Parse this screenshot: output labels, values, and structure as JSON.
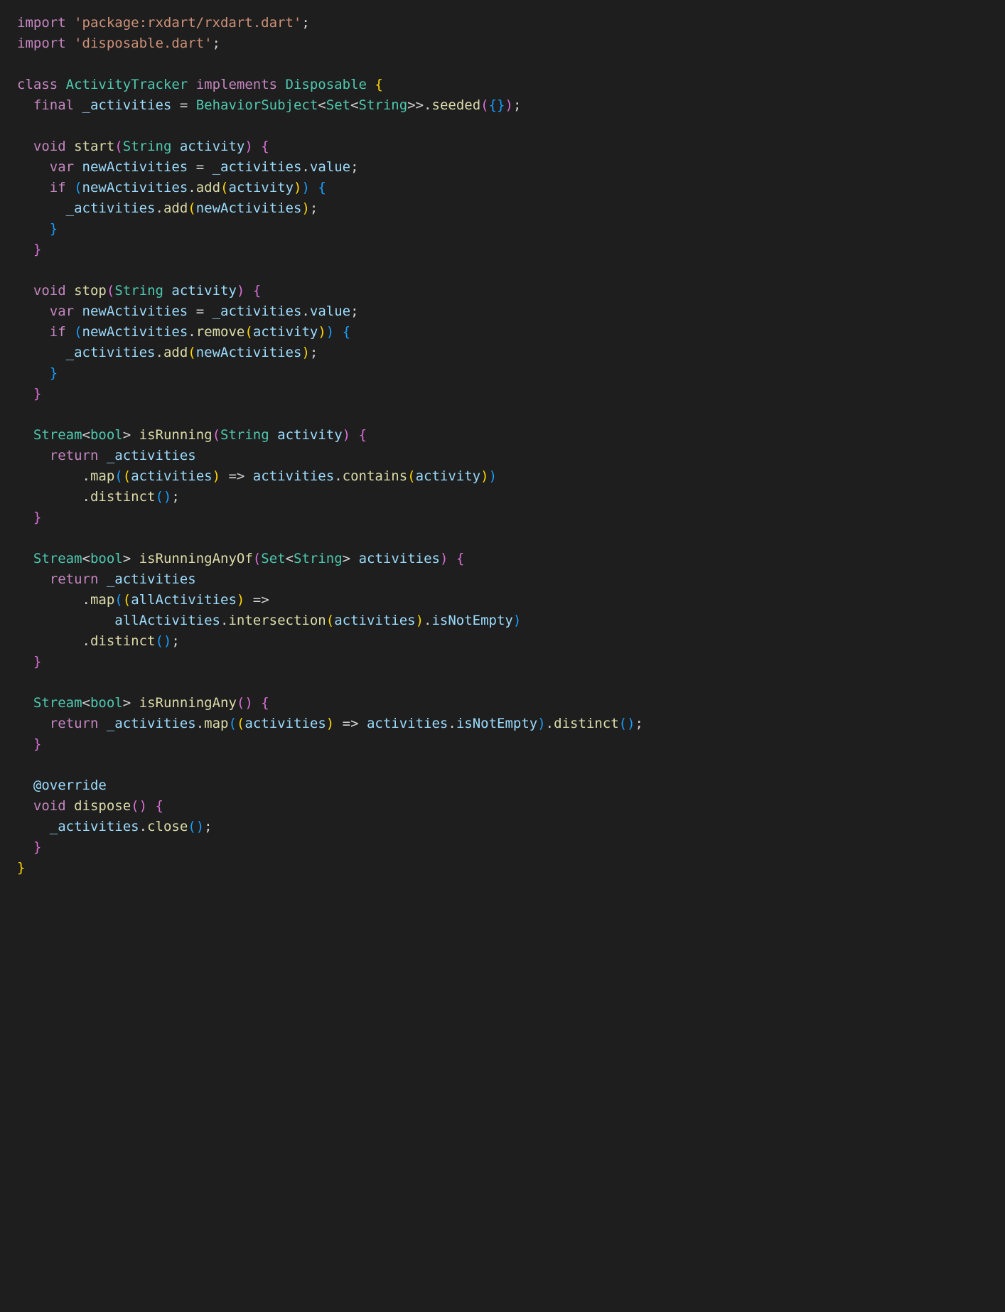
{
  "lines": [
    [
      {
        "t": "import ",
        "c": "kw"
      },
      {
        "t": "'package:rxdart/rxdart.dart'",
        "c": "str"
      },
      {
        "t": ";",
        "c": "punc"
      }
    ],
    [
      {
        "t": "import ",
        "c": "kw"
      },
      {
        "t": "'disposable.dart'",
        "c": "str"
      },
      {
        "t": ";",
        "c": "punc"
      }
    ],
    [],
    [
      {
        "t": "class ",
        "c": "kw"
      },
      {
        "t": "ActivityTracker",
        "c": "type"
      },
      {
        "t": " ",
        "c": "punc"
      },
      {
        "t": "implements ",
        "c": "kw"
      },
      {
        "t": "Disposable",
        "c": "type"
      },
      {
        "t": " ",
        "c": "punc"
      },
      {
        "t": "{",
        "c": "brace-y"
      }
    ],
    [
      {
        "t": "  ",
        "c": "punc"
      },
      {
        "t": "final ",
        "c": "kw"
      },
      {
        "t": "_activities",
        "c": "var"
      },
      {
        "t": " = ",
        "c": "op"
      },
      {
        "t": "BehaviorSubject",
        "c": "type"
      },
      {
        "t": "<",
        "c": "punc"
      },
      {
        "t": "Set",
        "c": "type"
      },
      {
        "t": "<",
        "c": "punc"
      },
      {
        "t": "String",
        "c": "type"
      },
      {
        "t": ">>.",
        "c": "punc"
      },
      {
        "t": "seeded",
        "c": "func"
      },
      {
        "t": "(",
        "c": "brace-p"
      },
      {
        "t": "{}",
        "c": "brace-b"
      },
      {
        "t": ")",
        "c": "brace-p"
      },
      {
        "t": ";",
        "c": "punc"
      }
    ],
    [],
    [
      {
        "t": "  ",
        "c": "punc"
      },
      {
        "t": "void ",
        "c": "kw"
      },
      {
        "t": "start",
        "c": "func"
      },
      {
        "t": "(",
        "c": "brace-p"
      },
      {
        "t": "String",
        "c": "type"
      },
      {
        "t": " ",
        "c": "punc"
      },
      {
        "t": "activity",
        "c": "var"
      },
      {
        "t": ")",
        "c": "brace-p"
      },
      {
        "t": " ",
        "c": "punc"
      },
      {
        "t": "{",
        "c": "brace-p"
      }
    ],
    [
      {
        "t": "    ",
        "c": "punc"
      },
      {
        "t": "var ",
        "c": "kw"
      },
      {
        "t": "newActivities",
        "c": "var"
      },
      {
        "t": " = ",
        "c": "op"
      },
      {
        "t": "_activities",
        "c": "var"
      },
      {
        "t": ".",
        "c": "punc"
      },
      {
        "t": "value",
        "c": "prop"
      },
      {
        "t": ";",
        "c": "punc"
      }
    ],
    [
      {
        "t": "    ",
        "c": "punc"
      },
      {
        "t": "if ",
        "c": "kw"
      },
      {
        "t": "(",
        "c": "brace-b"
      },
      {
        "t": "newActivities",
        "c": "var"
      },
      {
        "t": ".",
        "c": "punc"
      },
      {
        "t": "add",
        "c": "func"
      },
      {
        "t": "(",
        "c": "brace-y"
      },
      {
        "t": "activity",
        "c": "var"
      },
      {
        "t": ")",
        "c": "brace-y"
      },
      {
        "t": ")",
        "c": "brace-b"
      },
      {
        "t": " ",
        "c": "punc"
      },
      {
        "t": "{",
        "c": "brace-b"
      }
    ],
    [
      {
        "t": "      ",
        "c": "punc"
      },
      {
        "t": "_activities",
        "c": "var"
      },
      {
        "t": ".",
        "c": "punc"
      },
      {
        "t": "add",
        "c": "func"
      },
      {
        "t": "(",
        "c": "brace-y"
      },
      {
        "t": "newActivities",
        "c": "var"
      },
      {
        "t": ")",
        "c": "brace-y"
      },
      {
        "t": ";",
        "c": "punc"
      }
    ],
    [
      {
        "t": "    ",
        "c": "punc"
      },
      {
        "t": "}",
        "c": "brace-b"
      }
    ],
    [
      {
        "t": "  ",
        "c": "punc"
      },
      {
        "t": "}",
        "c": "brace-p"
      }
    ],
    [],
    [
      {
        "t": "  ",
        "c": "punc"
      },
      {
        "t": "void ",
        "c": "kw"
      },
      {
        "t": "stop",
        "c": "func"
      },
      {
        "t": "(",
        "c": "brace-p"
      },
      {
        "t": "String",
        "c": "type"
      },
      {
        "t": " ",
        "c": "punc"
      },
      {
        "t": "activity",
        "c": "var"
      },
      {
        "t": ")",
        "c": "brace-p"
      },
      {
        "t": " ",
        "c": "punc"
      },
      {
        "t": "{",
        "c": "brace-p"
      }
    ],
    [
      {
        "t": "    ",
        "c": "punc"
      },
      {
        "t": "var ",
        "c": "kw"
      },
      {
        "t": "newActivities",
        "c": "var"
      },
      {
        "t": " = ",
        "c": "op"
      },
      {
        "t": "_activities",
        "c": "var"
      },
      {
        "t": ".",
        "c": "punc"
      },
      {
        "t": "value",
        "c": "prop"
      },
      {
        "t": ";",
        "c": "punc"
      }
    ],
    [
      {
        "t": "    ",
        "c": "punc"
      },
      {
        "t": "if ",
        "c": "kw"
      },
      {
        "t": "(",
        "c": "brace-b"
      },
      {
        "t": "newActivities",
        "c": "var"
      },
      {
        "t": ".",
        "c": "punc"
      },
      {
        "t": "remove",
        "c": "func"
      },
      {
        "t": "(",
        "c": "brace-y"
      },
      {
        "t": "activity",
        "c": "var"
      },
      {
        "t": ")",
        "c": "brace-y"
      },
      {
        "t": ")",
        "c": "brace-b"
      },
      {
        "t": " ",
        "c": "punc"
      },
      {
        "t": "{",
        "c": "brace-b"
      }
    ],
    [
      {
        "t": "      ",
        "c": "punc"
      },
      {
        "t": "_activities",
        "c": "var"
      },
      {
        "t": ".",
        "c": "punc"
      },
      {
        "t": "add",
        "c": "func"
      },
      {
        "t": "(",
        "c": "brace-y"
      },
      {
        "t": "newActivities",
        "c": "var"
      },
      {
        "t": ")",
        "c": "brace-y"
      },
      {
        "t": ";",
        "c": "punc"
      }
    ],
    [
      {
        "t": "    ",
        "c": "punc"
      },
      {
        "t": "}",
        "c": "brace-b"
      }
    ],
    [
      {
        "t": "  ",
        "c": "punc"
      },
      {
        "t": "}",
        "c": "brace-p"
      }
    ],
    [],
    [
      {
        "t": "  ",
        "c": "punc"
      },
      {
        "t": "Stream",
        "c": "type"
      },
      {
        "t": "<",
        "c": "punc"
      },
      {
        "t": "bool",
        "c": "type"
      },
      {
        "t": "> ",
        "c": "punc"
      },
      {
        "t": "isRunning",
        "c": "func"
      },
      {
        "t": "(",
        "c": "brace-p"
      },
      {
        "t": "String",
        "c": "type"
      },
      {
        "t": " ",
        "c": "punc"
      },
      {
        "t": "activity",
        "c": "var"
      },
      {
        "t": ")",
        "c": "brace-p"
      },
      {
        "t": " ",
        "c": "punc"
      },
      {
        "t": "{",
        "c": "brace-p"
      }
    ],
    [
      {
        "t": "    ",
        "c": "punc"
      },
      {
        "t": "return ",
        "c": "kw"
      },
      {
        "t": "_activities",
        "c": "var"
      }
    ],
    [
      {
        "t": "        .",
        "c": "punc"
      },
      {
        "t": "map",
        "c": "func"
      },
      {
        "t": "(",
        "c": "brace-b"
      },
      {
        "t": "(",
        "c": "brace-y"
      },
      {
        "t": "activities",
        "c": "var"
      },
      {
        "t": ")",
        "c": "brace-y"
      },
      {
        "t": " => ",
        "c": "op"
      },
      {
        "t": "activities",
        "c": "var"
      },
      {
        "t": ".",
        "c": "punc"
      },
      {
        "t": "contains",
        "c": "func"
      },
      {
        "t": "(",
        "c": "brace-y"
      },
      {
        "t": "activity",
        "c": "var"
      },
      {
        "t": ")",
        "c": "brace-y"
      },
      {
        "t": ")",
        "c": "brace-b"
      }
    ],
    [
      {
        "t": "        .",
        "c": "punc"
      },
      {
        "t": "distinct",
        "c": "func"
      },
      {
        "t": "(",
        "c": "brace-b"
      },
      {
        "t": ")",
        "c": "brace-b"
      },
      {
        "t": ";",
        "c": "punc"
      }
    ],
    [
      {
        "t": "  ",
        "c": "punc"
      },
      {
        "t": "}",
        "c": "brace-p"
      }
    ],
    [],
    [
      {
        "t": "  ",
        "c": "punc"
      },
      {
        "t": "Stream",
        "c": "type"
      },
      {
        "t": "<",
        "c": "punc"
      },
      {
        "t": "bool",
        "c": "type"
      },
      {
        "t": "> ",
        "c": "punc"
      },
      {
        "t": "isRunningAnyOf",
        "c": "func"
      },
      {
        "t": "(",
        "c": "brace-p"
      },
      {
        "t": "Set",
        "c": "type"
      },
      {
        "t": "<",
        "c": "punc"
      },
      {
        "t": "String",
        "c": "type"
      },
      {
        "t": "> ",
        "c": "punc"
      },
      {
        "t": "activities",
        "c": "var"
      },
      {
        "t": ")",
        "c": "brace-p"
      },
      {
        "t": " ",
        "c": "punc"
      },
      {
        "t": "{",
        "c": "brace-p"
      }
    ],
    [
      {
        "t": "    ",
        "c": "punc"
      },
      {
        "t": "return ",
        "c": "kw"
      },
      {
        "t": "_activities",
        "c": "var"
      }
    ],
    [
      {
        "t": "        .",
        "c": "punc"
      },
      {
        "t": "map",
        "c": "func"
      },
      {
        "t": "(",
        "c": "brace-b"
      },
      {
        "t": "(",
        "c": "brace-y"
      },
      {
        "t": "allActivities",
        "c": "var"
      },
      {
        "t": ")",
        "c": "brace-y"
      },
      {
        "t": " =>",
        "c": "op"
      }
    ],
    [
      {
        "t": "            ",
        "c": "punc"
      },
      {
        "t": "allActivities",
        "c": "var"
      },
      {
        "t": ".",
        "c": "punc"
      },
      {
        "t": "intersection",
        "c": "func"
      },
      {
        "t": "(",
        "c": "brace-y"
      },
      {
        "t": "activities",
        "c": "var"
      },
      {
        "t": ")",
        "c": "brace-y"
      },
      {
        "t": ".",
        "c": "punc"
      },
      {
        "t": "isNotEmpty",
        "c": "prop"
      },
      {
        "t": ")",
        "c": "brace-b"
      }
    ],
    [
      {
        "t": "        .",
        "c": "punc"
      },
      {
        "t": "distinct",
        "c": "func"
      },
      {
        "t": "(",
        "c": "brace-b"
      },
      {
        "t": ")",
        "c": "brace-b"
      },
      {
        "t": ";",
        "c": "punc"
      }
    ],
    [
      {
        "t": "  ",
        "c": "punc"
      },
      {
        "t": "}",
        "c": "brace-p"
      }
    ],
    [],
    [
      {
        "t": "  ",
        "c": "punc"
      },
      {
        "t": "Stream",
        "c": "type"
      },
      {
        "t": "<",
        "c": "punc"
      },
      {
        "t": "bool",
        "c": "type"
      },
      {
        "t": "> ",
        "c": "punc"
      },
      {
        "t": "isRunningAny",
        "c": "func"
      },
      {
        "t": "(",
        "c": "brace-p"
      },
      {
        "t": ")",
        "c": "brace-p"
      },
      {
        "t": " ",
        "c": "punc"
      },
      {
        "t": "{",
        "c": "brace-p"
      }
    ],
    [
      {
        "t": "    ",
        "c": "punc"
      },
      {
        "t": "return ",
        "c": "kw"
      },
      {
        "t": "_activities",
        "c": "var"
      },
      {
        "t": ".",
        "c": "punc"
      },
      {
        "t": "map",
        "c": "func"
      },
      {
        "t": "(",
        "c": "brace-b"
      },
      {
        "t": "(",
        "c": "brace-y"
      },
      {
        "t": "activities",
        "c": "var"
      },
      {
        "t": ")",
        "c": "brace-y"
      },
      {
        "t": " => ",
        "c": "op"
      },
      {
        "t": "activities",
        "c": "var"
      },
      {
        "t": ".",
        "c": "punc"
      },
      {
        "t": "isNotEmpty",
        "c": "prop"
      },
      {
        "t": ")",
        "c": "brace-b"
      },
      {
        "t": ".",
        "c": "punc"
      },
      {
        "t": "distinct",
        "c": "func"
      },
      {
        "t": "(",
        "c": "brace-b"
      },
      {
        "t": ")",
        "c": "brace-b"
      },
      {
        "t": ";",
        "c": "punc"
      }
    ],
    [
      {
        "t": "  ",
        "c": "punc"
      },
      {
        "t": "}",
        "c": "brace-p"
      }
    ],
    [],
    [
      {
        "t": "  ",
        "c": "punc"
      },
      {
        "t": "@override",
        "c": "anno"
      }
    ],
    [
      {
        "t": "  ",
        "c": "punc"
      },
      {
        "t": "void ",
        "c": "kw"
      },
      {
        "t": "dispose",
        "c": "func"
      },
      {
        "t": "(",
        "c": "brace-p"
      },
      {
        "t": ")",
        "c": "brace-p"
      },
      {
        "t": " ",
        "c": "punc"
      },
      {
        "t": "{",
        "c": "brace-p"
      }
    ],
    [
      {
        "t": "    ",
        "c": "punc"
      },
      {
        "t": "_activities",
        "c": "var"
      },
      {
        "t": ".",
        "c": "punc"
      },
      {
        "t": "close",
        "c": "func"
      },
      {
        "t": "(",
        "c": "brace-b"
      },
      {
        "t": ")",
        "c": "brace-b"
      },
      {
        "t": ";",
        "c": "punc"
      }
    ],
    [
      {
        "t": "  ",
        "c": "punc"
      },
      {
        "t": "}",
        "c": "brace-p"
      }
    ],
    [
      {
        "t": "}",
        "c": "brace-y"
      }
    ]
  ]
}
